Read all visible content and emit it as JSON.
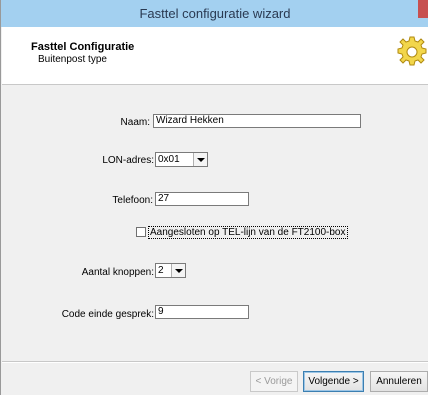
{
  "window": {
    "title": "Fasttel configuratie wizard"
  },
  "header": {
    "title": "Fasttel Configuratie",
    "subtitle": "Buitenpost type"
  },
  "form": {
    "naam": {
      "label": "Naam:",
      "value": "Wizard Hekken"
    },
    "lon_adres": {
      "label": "LON-adres:",
      "value": "0x01"
    },
    "telefoon": {
      "label": "Telefoon:",
      "value": "27"
    },
    "aangesloten": {
      "label": "Aangesloten op TEL-lijn van de FT2100-box",
      "checked": false
    },
    "aantal_knoppen": {
      "label": "Aantal knoppen:",
      "value": "2"
    },
    "code_einde": {
      "label": "Code einde gesprek:",
      "value": "9"
    }
  },
  "footer": {
    "back_label": "< Vorige",
    "next_label": "Volgende >",
    "cancel_label": "Annuleren"
  },
  "colors": {
    "titlebar": "#a3d0f0",
    "close": "#c75050",
    "accent": "#3c7fb1"
  }
}
